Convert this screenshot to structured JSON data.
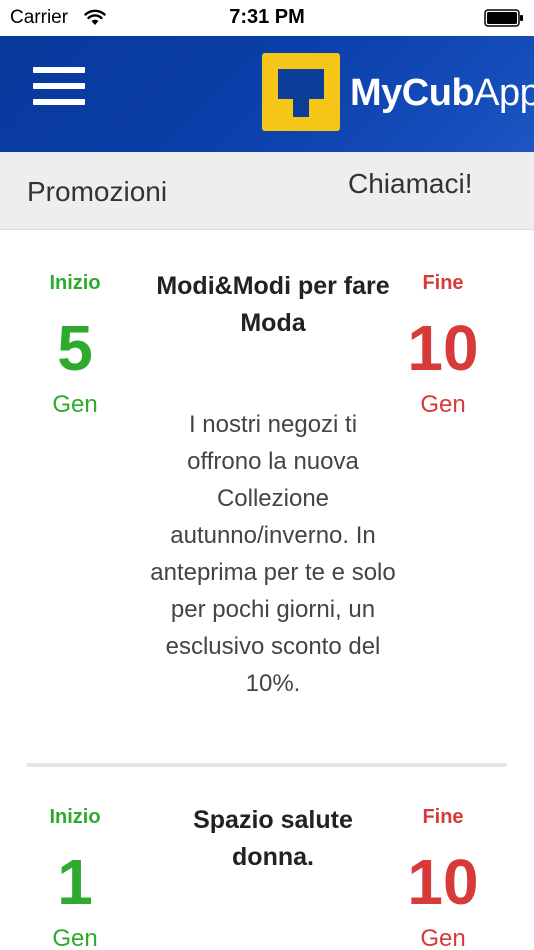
{
  "status_bar": {
    "carrier": "Carrier",
    "time": "7:31 PM"
  },
  "header": {
    "app_name_bold": "MyCub",
    "app_name_light": "App",
    "logo_color": "#f5c518"
  },
  "sub_bar": {
    "promotions_label": "Promozioni",
    "call_label": "Chiamaci!"
  },
  "promotions": [
    {
      "start_label": "Inizio",
      "start_day": "5",
      "start_month": "Gen",
      "title": "Modi&Modi per fare Moda",
      "description": "I nostri negozi ti offrono la nuova Collezione autunno/inverno. In anteprima per te e solo per pochi giorni, un esclusivo sconto del 10%.",
      "end_label": "Fine",
      "end_day": "10",
      "end_month": "Gen"
    },
    {
      "start_label": "Inizio",
      "start_day": "1",
      "start_month": "Gen",
      "title": "Spazio salute donna.",
      "description": "",
      "end_label": "Fine",
      "end_day": "10",
      "end_month": "Gen"
    }
  ],
  "colors": {
    "header_blue": "#0a3ea8",
    "start_green": "#2eaa2e",
    "end_red": "#d83a3a"
  }
}
